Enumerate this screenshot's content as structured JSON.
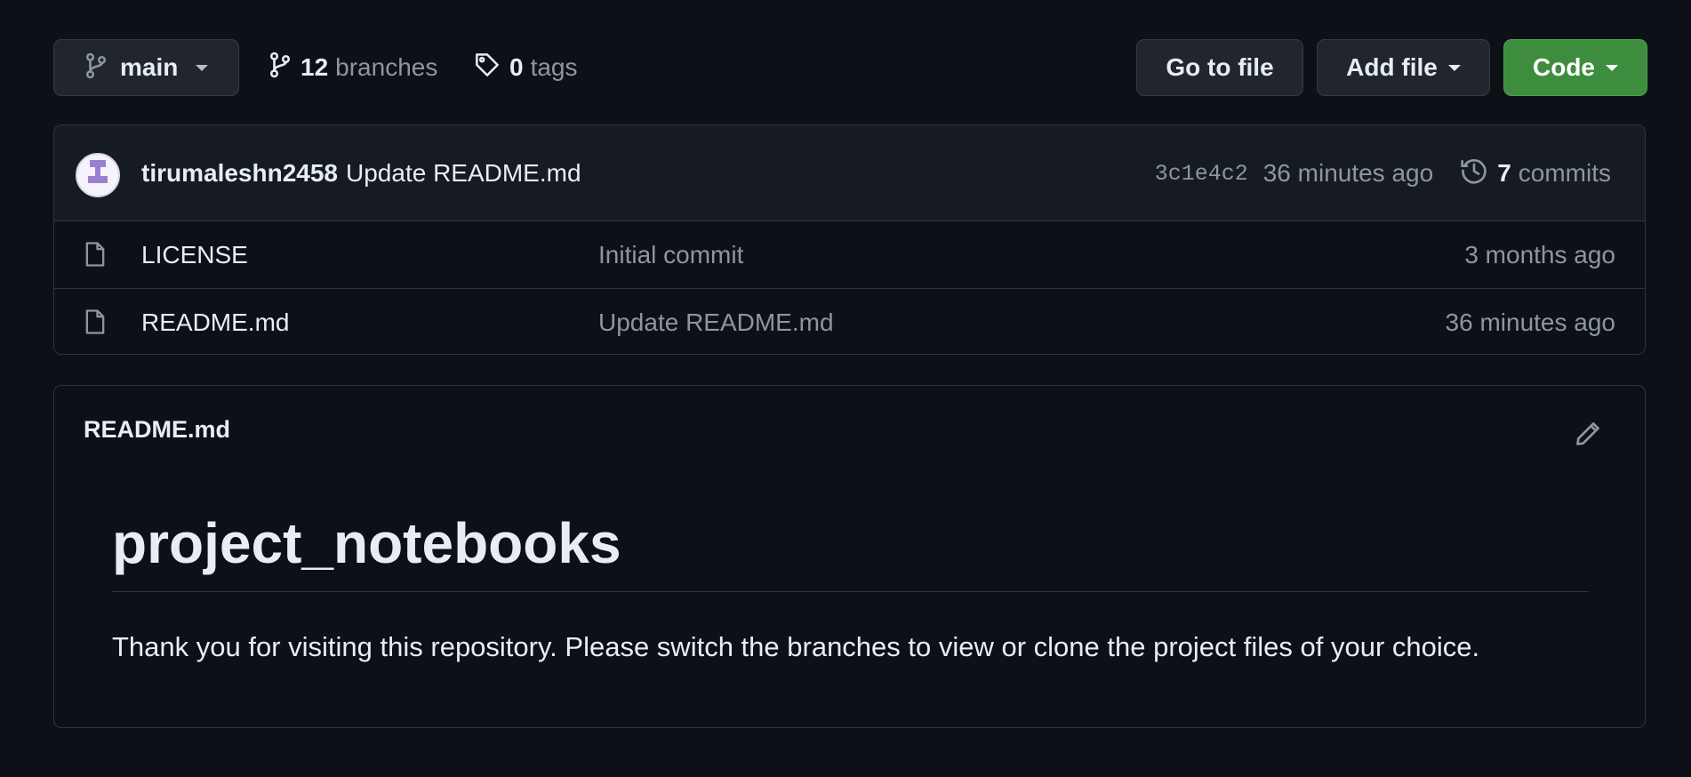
{
  "toolbar": {
    "branch_name": "main",
    "branches_count": "12",
    "branches_label": "branches",
    "tags_count": "0",
    "tags_label": "tags",
    "go_to_file_label": "Go to file",
    "add_file_label": "Add file",
    "code_label": "Code"
  },
  "latest_commit": {
    "author": "tirumaleshn2458",
    "message": "Update README.md",
    "sha": "3c1e4c2",
    "time": "36 minutes ago",
    "commits_count": "7",
    "commits_label": "commits"
  },
  "files": [
    {
      "icon": "file-icon",
      "name": "LICENSE",
      "message": "Initial commit",
      "age": "3 months ago"
    },
    {
      "icon": "file-icon",
      "name": "README.md",
      "message": "Update README.md",
      "age": "36 minutes ago"
    }
  ],
  "readme": {
    "filename": "README.md",
    "title": "project_notebooks",
    "body": "Thank you for visiting this repository. Please switch the branches to view or clone the project files of your choice."
  },
  "colors": {
    "background": "#0d1117",
    "button": "#21262d",
    "code_button": "#3e8d3f",
    "muted_text": "#8d96a0",
    "border": "#30363d"
  }
}
